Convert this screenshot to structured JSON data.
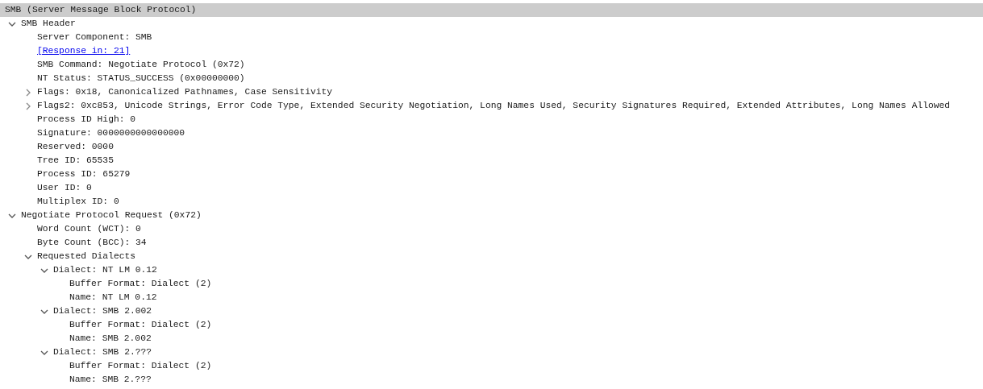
{
  "tree": [
    {
      "label": "SMB (Server Message Block Protocol)",
      "kind": "field",
      "selected": true,
      "children": [
        {
          "label": "SMB Header",
          "kind": "field",
          "selected": false,
          "expanded": true,
          "children": [
            {
              "label": "Server Component: SMB",
              "kind": "field",
              "selected": false
            },
            {
              "label": "[Response in: 21]",
              "kind": "link",
              "selected": false
            },
            {
              "label": "SMB Command: Negotiate Protocol (0x72)",
              "kind": "field",
              "selected": false
            },
            {
              "label": "NT Status: STATUS_SUCCESS (0x00000000)",
              "kind": "field",
              "selected": false
            },
            {
              "label": "Flags: 0x18, Canonicalized Pathnames, Case Sensitivity",
              "kind": "field",
              "selected": false,
              "expanded": false
            },
            {
              "label": "Flags2: 0xc853, Unicode Strings, Error Code Type, Extended Security Negotiation, Long Names Used, Security Signatures Required, Extended Attributes, Long Names Allowed",
              "kind": "field",
              "selected": false,
              "expanded": false
            },
            {
              "label": "Process ID High: 0",
              "kind": "field",
              "selected": false
            },
            {
              "label": "Signature: 0000000000000000",
              "kind": "field",
              "selected": false
            },
            {
              "label": "Reserved: 0000",
              "kind": "field",
              "selected": false
            },
            {
              "label": "Tree ID: 65535",
              "kind": "field",
              "selected": false
            },
            {
              "label": "Process ID: 65279",
              "kind": "field",
              "selected": false
            },
            {
              "label": "User ID: 0",
              "kind": "field",
              "selected": false
            },
            {
              "label": "Multiplex ID: 0",
              "kind": "field",
              "selected": false
            }
          ]
        },
        {
          "label": "Negotiate Protocol Request (0x72)",
          "kind": "field",
          "selected": false,
          "expanded": true,
          "children": [
            {
              "label": "Word Count (WCT): 0",
              "kind": "field",
              "selected": false
            },
            {
              "label": "Byte Count (BCC): 34",
              "kind": "field",
              "selected": false
            },
            {
              "label": "Requested Dialects",
              "kind": "field",
              "selected": false,
              "expanded": true,
              "children": [
                {
                  "label": "Dialect: NT LM 0.12",
                  "kind": "field",
                  "selected": false,
                  "expanded": true,
                  "children": [
                    {
                      "label": "Buffer Format: Dialect (2)",
                      "kind": "field",
                      "selected": false
                    },
                    {
                      "label": "Name: NT LM 0.12",
                      "kind": "field",
                      "selected": false
                    }
                  ]
                },
                {
                  "label": "Dialect: SMB 2.002",
                  "kind": "field",
                  "selected": false,
                  "expanded": true,
                  "children": [
                    {
                      "label": "Buffer Format: Dialect (2)",
                      "kind": "field",
                      "selected": false
                    },
                    {
                      "label": "Name: SMB 2.002",
                      "kind": "field",
                      "selected": false
                    }
                  ]
                },
                {
                  "label": "Dialect: SMB 2.???",
                  "kind": "field",
                  "selected": false,
                  "expanded": true,
                  "children": [
                    {
                      "label": "Buffer Format: Dialect (2)",
                      "kind": "field",
                      "selected": false
                    },
                    {
                      "label": "Name: SMB 2.???",
                      "kind": "field",
                      "selected": false
                    }
                  ]
                }
              ]
            }
          ]
        }
      ]
    }
  ]
}
